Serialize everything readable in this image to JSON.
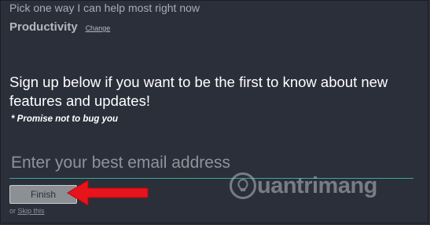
{
  "header": {
    "prompt": "Pick one way I can help most right now",
    "category": "Productivity",
    "change_label": "Change"
  },
  "main": {
    "headline": "Sign up below if you want to be the first to know about new features and updates!",
    "promise": "* Promise not to bug you"
  },
  "form": {
    "email_placeholder": "Enter your best email address",
    "email_value": "",
    "finish_label": "Finish",
    "or_text": "or ",
    "skip_label": "Skip this"
  },
  "watermark": {
    "text": "uantrimang"
  },
  "colors": {
    "background": "#2b2f3a",
    "input_underline": "#38a89d",
    "arrow": "#e8141b"
  }
}
